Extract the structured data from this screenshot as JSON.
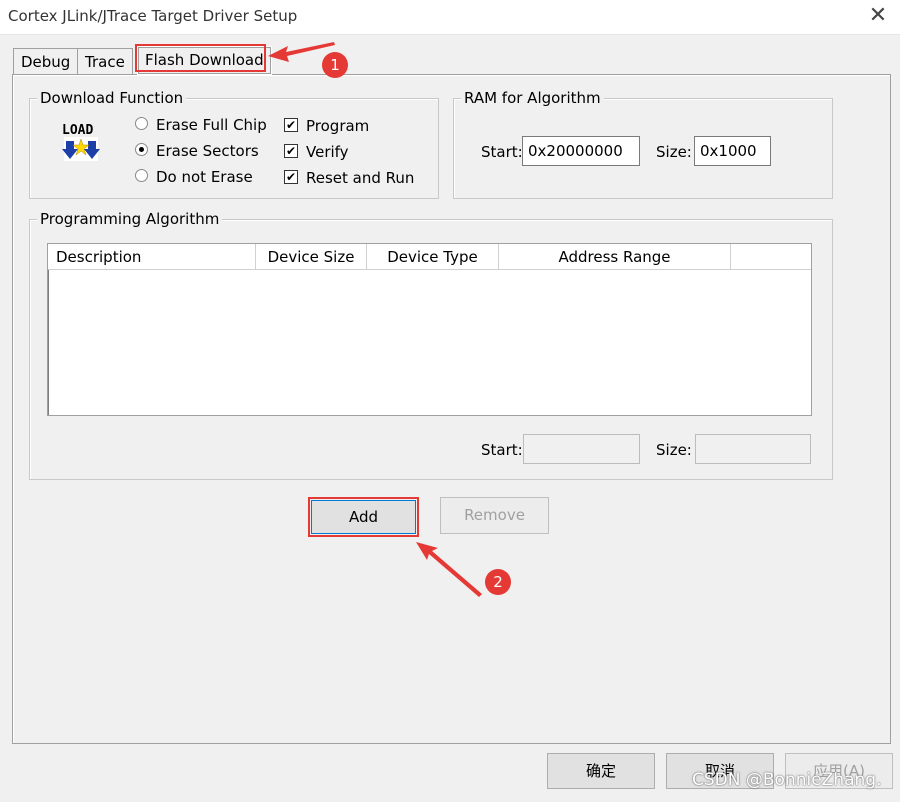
{
  "window": {
    "title": "Cortex JLink/JTrace Target Driver Setup",
    "close_glyph": "✕"
  },
  "tabs": [
    {
      "label": "Debug"
    },
    {
      "label": "Trace"
    },
    {
      "label": "Flash Download",
      "selected": true
    }
  ],
  "download_function": {
    "label": "Download Function",
    "icon_text": "LOAD",
    "radios": [
      {
        "label": "Erase Full Chip",
        "checked": false
      },
      {
        "label": "Erase Sectors",
        "checked": true
      },
      {
        "label": "Do not Erase",
        "checked": false
      }
    ],
    "checkboxes": [
      {
        "label": "Program",
        "checked": true
      },
      {
        "label": "Verify",
        "checked": true
      },
      {
        "label": "Reset and Run",
        "checked": true
      }
    ]
  },
  "ram": {
    "label": "RAM for Algorithm",
    "start_label": "Start:",
    "start_value": "0x20000000",
    "size_label": "Size:",
    "size_value": "0x1000"
  },
  "programming_algorithm": {
    "label": "Programming Algorithm",
    "columns": [
      "Description",
      "Device Size",
      "Device Type",
      "Address Range"
    ],
    "rows": [],
    "start_label": "Start:",
    "start_value": "",
    "size_label": "Size:",
    "size_value": ""
  },
  "buttons": {
    "add": "Add",
    "remove": "Remove",
    "ok": "确定",
    "cancel": "取消",
    "apply": "应用(A)"
  },
  "annotations": {
    "badge1": "1",
    "badge2": "2"
  },
  "watermark": "CSDN @BonnieZhang.",
  "colors": {
    "highlight": "#e53935",
    "window_bg": "#f0f0f0",
    "focus_border": "#0078d7"
  },
  "icons": {
    "checkmark": "✔",
    "load_arrow": "load-arrow-icon"
  }
}
